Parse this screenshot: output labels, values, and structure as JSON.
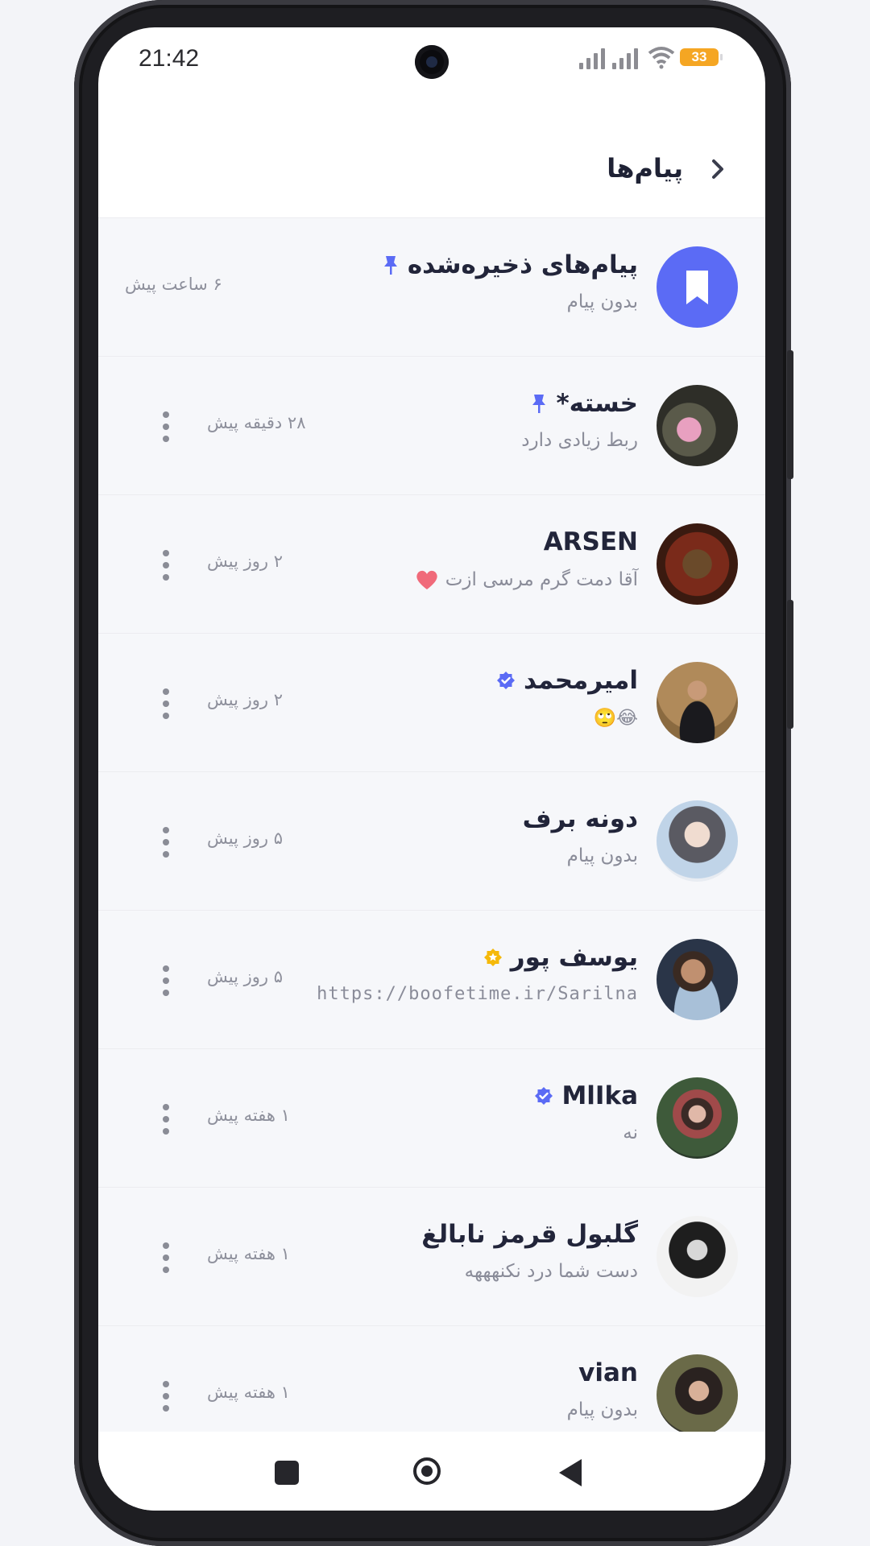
{
  "status_bar": {
    "time": "21:42",
    "battery": "33"
  },
  "header": {
    "title": "پیام‌ها",
    "back_icon": "chevron-left-icon"
  },
  "colors": {
    "accent": "#5b6bf5",
    "verified": "#5b6bf5",
    "gold": "#f5b90a",
    "background": "#f6f7fa"
  },
  "conversations": [
    {
      "name": "پیام‌های ذخیره‌شده",
      "preview": "بدون پیام",
      "time": "۶ ساعت پیش",
      "pinned": true,
      "avatar_icon": "bookmark-icon"
    },
    {
      "name": "خسته*",
      "preview": "ربط زیادی دارد",
      "time": "۲۸ دقیقه پیش",
      "pinned": true
    },
    {
      "name": "ARSEN",
      "preview": "آقا دمت گرم مرسی ازت",
      "preview_icon": "heart-icon",
      "time": "۲ روز پیش"
    },
    {
      "name": "امیرمحمد",
      "preview": "😂🙄",
      "time": "۲ روز پیش",
      "badge": "verified"
    },
    {
      "name": "دونه برف",
      "preview": "بدون پیام",
      "time": "۵ روز پیش"
    },
    {
      "name": "یوسف پور",
      "preview": "https://boofetime.ir/Sarilna",
      "time": "۵ روز پیش",
      "badge": "gold"
    },
    {
      "name": "MlIka",
      "preview": "نه",
      "time": "۱ هفته پیش",
      "badge": "verified"
    },
    {
      "name": "گلبول قرمز نابالغ",
      "preview": "دست شما درد نکنهههه",
      "time": "۱ هفته پیش"
    },
    {
      "name": "vian",
      "preview": "بدون پیام",
      "time": "۱ هفته پیش"
    }
  ],
  "navigation": {
    "icons": [
      "recents-square-icon",
      "home-circle-icon",
      "back-triangle-icon"
    ]
  }
}
